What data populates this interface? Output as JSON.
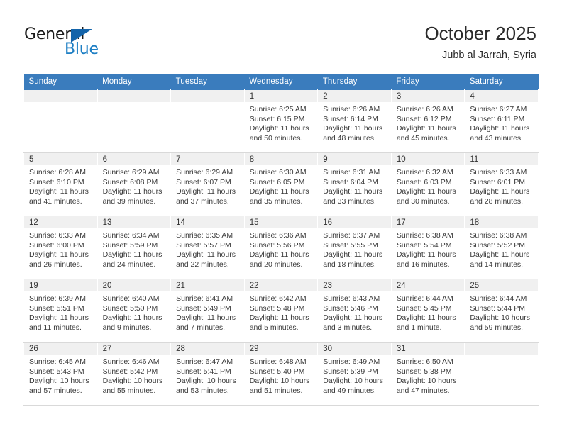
{
  "logo": {
    "text_top": "General",
    "text_bottom": "Blue",
    "triangle_color": "#1464aa",
    "blue_color": "#1e7fc4"
  },
  "header": {
    "title": "October 2025",
    "subtitle": "Jubb al Jarrah, Syria"
  },
  "theme": {
    "header_blue": "#3a7cbd",
    "daynum_gray": "#f0f0f0",
    "grid_line": "#d9d9d9"
  },
  "calendar": {
    "weekday_headers": [
      "Sunday",
      "Monday",
      "Tuesday",
      "Wednesday",
      "Thursday",
      "Friday",
      "Saturday"
    ],
    "weeks": [
      [
        {
          "day": "",
          "empty": true,
          "sunrise": "",
          "sunset": "",
          "daylight_line1": "",
          "daylight_line2": ""
        },
        {
          "day": "",
          "empty": true,
          "sunrise": "",
          "sunset": "",
          "daylight_line1": "",
          "daylight_line2": ""
        },
        {
          "day": "",
          "empty": true,
          "sunrise": "",
          "sunset": "",
          "daylight_line1": "",
          "daylight_line2": ""
        },
        {
          "day": "1",
          "empty": false,
          "sunrise": "Sunrise: 6:25 AM",
          "sunset": "Sunset: 6:15 PM",
          "daylight_line1": "Daylight: 11 hours",
          "daylight_line2": "and 50 minutes."
        },
        {
          "day": "2",
          "empty": false,
          "sunrise": "Sunrise: 6:26 AM",
          "sunset": "Sunset: 6:14 PM",
          "daylight_line1": "Daylight: 11 hours",
          "daylight_line2": "and 48 minutes."
        },
        {
          "day": "3",
          "empty": false,
          "sunrise": "Sunrise: 6:26 AM",
          "sunset": "Sunset: 6:12 PM",
          "daylight_line1": "Daylight: 11 hours",
          "daylight_line2": "and 45 minutes."
        },
        {
          "day": "4",
          "empty": false,
          "sunrise": "Sunrise: 6:27 AM",
          "sunset": "Sunset: 6:11 PM",
          "daylight_line1": "Daylight: 11 hours",
          "daylight_line2": "and 43 minutes."
        }
      ],
      [
        {
          "day": "5",
          "empty": false,
          "sunrise": "Sunrise: 6:28 AM",
          "sunset": "Sunset: 6:10 PM",
          "daylight_line1": "Daylight: 11 hours",
          "daylight_line2": "and 41 minutes."
        },
        {
          "day": "6",
          "empty": false,
          "sunrise": "Sunrise: 6:29 AM",
          "sunset": "Sunset: 6:08 PM",
          "daylight_line1": "Daylight: 11 hours",
          "daylight_line2": "and 39 minutes."
        },
        {
          "day": "7",
          "empty": false,
          "sunrise": "Sunrise: 6:29 AM",
          "sunset": "Sunset: 6:07 PM",
          "daylight_line1": "Daylight: 11 hours",
          "daylight_line2": "and 37 minutes."
        },
        {
          "day": "8",
          "empty": false,
          "sunrise": "Sunrise: 6:30 AM",
          "sunset": "Sunset: 6:05 PM",
          "daylight_line1": "Daylight: 11 hours",
          "daylight_line2": "and 35 minutes."
        },
        {
          "day": "9",
          "empty": false,
          "sunrise": "Sunrise: 6:31 AM",
          "sunset": "Sunset: 6:04 PM",
          "daylight_line1": "Daylight: 11 hours",
          "daylight_line2": "and 33 minutes."
        },
        {
          "day": "10",
          "empty": false,
          "sunrise": "Sunrise: 6:32 AM",
          "sunset": "Sunset: 6:03 PM",
          "daylight_line1": "Daylight: 11 hours",
          "daylight_line2": "and 30 minutes."
        },
        {
          "day": "11",
          "empty": false,
          "sunrise": "Sunrise: 6:33 AM",
          "sunset": "Sunset: 6:01 PM",
          "daylight_line1": "Daylight: 11 hours",
          "daylight_line2": "and 28 minutes."
        }
      ],
      [
        {
          "day": "12",
          "empty": false,
          "sunrise": "Sunrise: 6:33 AM",
          "sunset": "Sunset: 6:00 PM",
          "daylight_line1": "Daylight: 11 hours",
          "daylight_line2": "and 26 minutes."
        },
        {
          "day": "13",
          "empty": false,
          "sunrise": "Sunrise: 6:34 AM",
          "sunset": "Sunset: 5:59 PM",
          "daylight_line1": "Daylight: 11 hours",
          "daylight_line2": "and 24 minutes."
        },
        {
          "day": "14",
          "empty": false,
          "sunrise": "Sunrise: 6:35 AM",
          "sunset": "Sunset: 5:57 PM",
          "daylight_line1": "Daylight: 11 hours",
          "daylight_line2": "and 22 minutes."
        },
        {
          "day": "15",
          "empty": false,
          "sunrise": "Sunrise: 6:36 AM",
          "sunset": "Sunset: 5:56 PM",
          "daylight_line1": "Daylight: 11 hours",
          "daylight_line2": "and 20 minutes."
        },
        {
          "day": "16",
          "empty": false,
          "sunrise": "Sunrise: 6:37 AM",
          "sunset": "Sunset: 5:55 PM",
          "daylight_line1": "Daylight: 11 hours",
          "daylight_line2": "and 18 minutes."
        },
        {
          "day": "17",
          "empty": false,
          "sunrise": "Sunrise: 6:38 AM",
          "sunset": "Sunset: 5:54 PM",
          "daylight_line1": "Daylight: 11 hours",
          "daylight_line2": "and 16 minutes."
        },
        {
          "day": "18",
          "empty": false,
          "sunrise": "Sunrise: 6:38 AM",
          "sunset": "Sunset: 5:52 PM",
          "daylight_line1": "Daylight: 11 hours",
          "daylight_line2": "and 14 minutes."
        }
      ],
      [
        {
          "day": "19",
          "empty": false,
          "sunrise": "Sunrise: 6:39 AM",
          "sunset": "Sunset: 5:51 PM",
          "daylight_line1": "Daylight: 11 hours",
          "daylight_line2": "and 11 minutes."
        },
        {
          "day": "20",
          "empty": false,
          "sunrise": "Sunrise: 6:40 AM",
          "sunset": "Sunset: 5:50 PM",
          "daylight_line1": "Daylight: 11 hours",
          "daylight_line2": "and 9 minutes."
        },
        {
          "day": "21",
          "empty": false,
          "sunrise": "Sunrise: 6:41 AM",
          "sunset": "Sunset: 5:49 PM",
          "daylight_line1": "Daylight: 11 hours",
          "daylight_line2": "and 7 minutes."
        },
        {
          "day": "22",
          "empty": false,
          "sunrise": "Sunrise: 6:42 AM",
          "sunset": "Sunset: 5:48 PM",
          "daylight_line1": "Daylight: 11 hours",
          "daylight_line2": "and 5 minutes."
        },
        {
          "day": "23",
          "empty": false,
          "sunrise": "Sunrise: 6:43 AM",
          "sunset": "Sunset: 5:46 PM",
          "daylight_line1": "Daylight: 11 hours",
          "daylight_line2": "and 3 minutes."
        },
        {
          "day": "24",
          "empty": false,
          "sunrise": "Sunrise: 6:44 AM",
          "sunset": "Sunset: 5:45 PM",
          "daylight_line1": "Daylight: 11 hours",
          "daylight_line2": "and 1 minute."
        },
        {
          "day": "25",
          "empty": false,
          "sunrise": "Sunrise: 6:44 AM",
          "sunset": "Sunset: 5:44 PM",
          "daylight_line1": "Daylight: 10 hours",
          "daylight_line2": "and 59 minutes."
        }
      ],
      [
        {
          "day": "26",
          "empty": false,
          "sunrise": "Sunrise: 6:45 AM",
          "sunset": "Sunset: 5:43 PM",
          "daylight_line1": "Daylight: 10 hours",
          "daylight_line2": "and 57 minutes."
        },
        {
          "day": "27",
          "empty": false,
          "sunrise": "Sunrise: 6:46 AM",
          "sunset": "Sunset: 5:42 PM",
          "daylight_line1": "Daylight: 10 hours",
          "daylight_line2": "and 55 minutes."
        },
        {
          "day": "28",
          "empty": false,
          "sunrise": "Sunrise: 6:47 AM",
          "sunset": "Sunset: 5:41 PM",
          "daylight_line1": "Daylight: 10 hours",
          "daylight_line2": "and 53 minutes."
        },
        {
          "day": "29",
          "empty": false,
          "sunrise": "Sunrise: 6:48 AM",
          "sunset": "Sunset: 5:40 PM",
          "daylight_line1": "Daylight: 10 hours",
          "daylight_line2": "and 51 minutes."
        },
        {
          "day": "30",
          "empty": false,
          "sunrise": "Sunrise: 6:49 AM",
          "sunset": "Sunset: 5:39 PM",
          "daylight_line1": "Daylight: 10 hours",
          "daylight_line2": "and 49 minutes."
        },
        {
          "day": "31",
          "empty": false,
          "sunrise": "Sunrise: 6:50 AM",
          "sunset": "Sunset: 5:38 PM",
          "daylight_line1": "Daylight: 10 hours",
          "daylight_line2": "and 47 minutes."
        },
        {
          "day": "",
          "empty": true,
          "sunrise": "",
          "sunset": "",
          "daylight_line1": "",
          "daylight_line2": ""
        }
      ]
    ]
  }
}
